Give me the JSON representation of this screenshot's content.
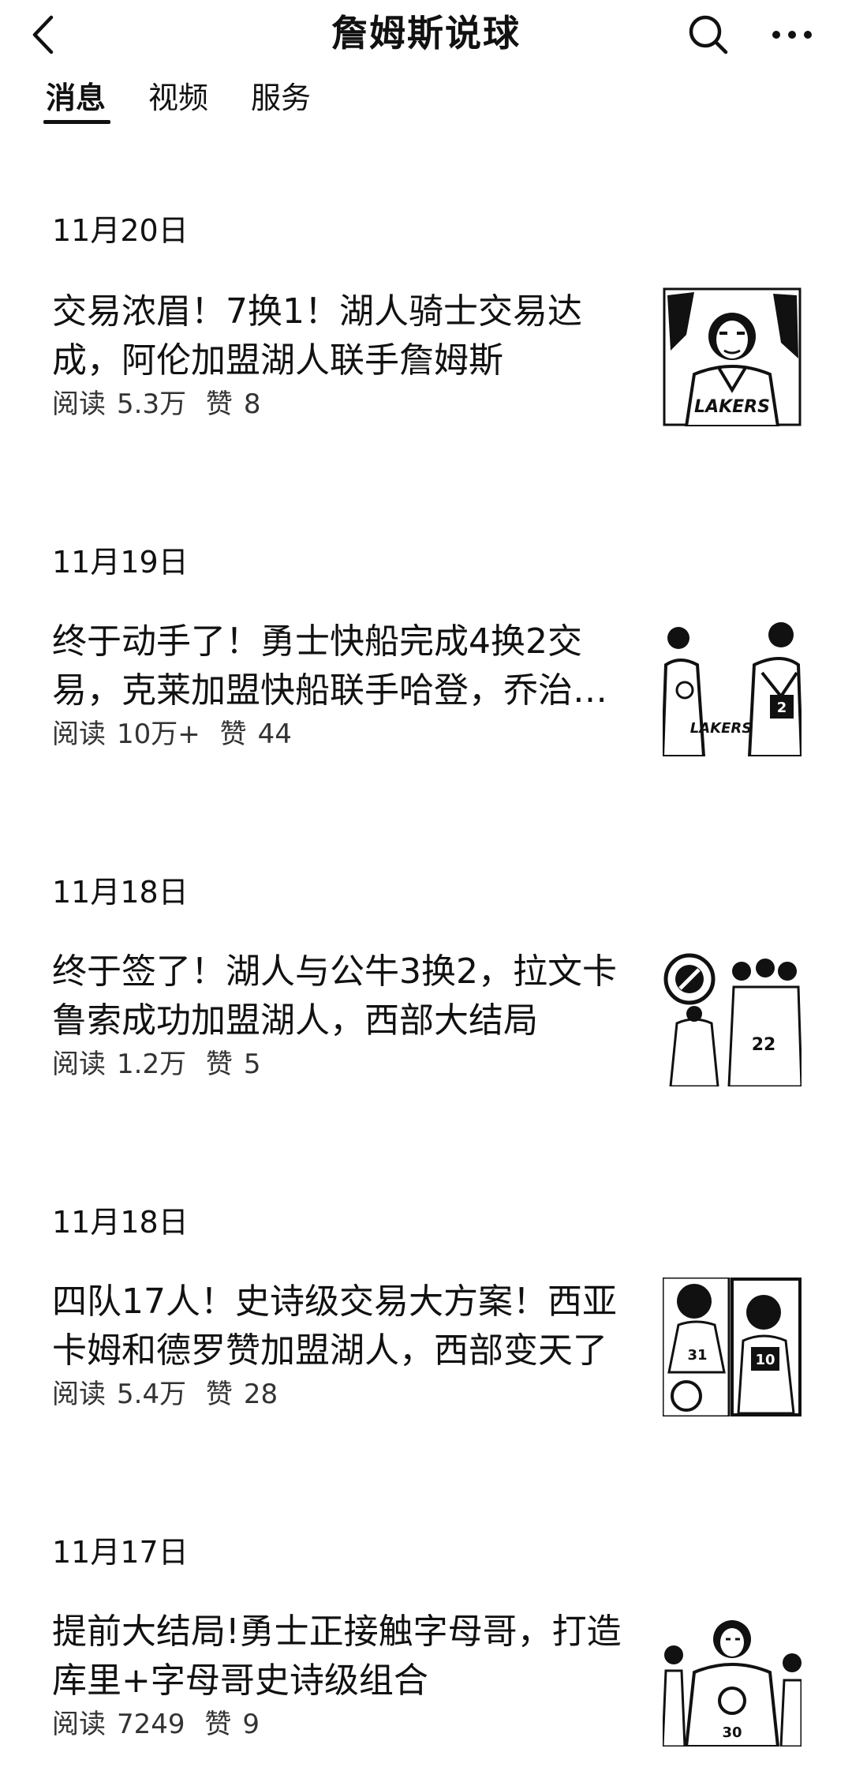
{
  "header": {
    "title": "詹姆斯说球",
    "back_icon": "chevron-left-icon",
    "search_icon": "search-icon",
    "more_icon": "more-horizontal-icon"
  },
  "tabs": [
    {
      "label": "消息",
      "active": true
    },
    {
      "label": "视频",
      "active": false
    },
    {
      "label": "服务",
      "active": false
    }
  ],
  "articles": [
    {
      "date": "11月20日",
      "title": "交易浓眉！7换1！湖人骑士交易达成，阿伦加盟湖人联手詹姆斯",
      "reads_label": "阅读",
      "reads": "5.3万",
      "likes_label": "赞",
      "likes": "8",
      "thumb_text": "LAKERS"
    },
    {
      "date": "11月19日",
      "title": "终于动手了！勇士快船完成4换2交易，克莱加盟快船联手哈登，乔治…",
      "reads_label": "阅读",
      "reads": "10万+",
      "likes_label": "赞",
      "likes": "44",
      "thumb_text": "LAKERS"
    },
    {
      "date": "11月18日",
      "title": "终于签了！湖人与公牛3换2，拉文卡鲁索成功加盟湖人，西部大结局",
      "reads_label": "阅读",
      "reads": "1.2万",
      "likes_label": "赞",
      "likes": "5",
      "thumb_text": "22"
    },
    {
      "date": "11月18日",
      "title": "四队17人！史诗级交易大方案！西亚卡姆和德罗赞加盟湖人，西部变天了",
      "reads_label": "阅读",
      "reads": "5.4万",
      "likes_label": "赞",
      "likes": "28",
      "thumb_text": "31"
    },
    {
      "date": "11月17日",
      "title": "提前大结局!勇士正接触字母哥，打造库里+字母哥史诗级组合",
      "reads_label": "阅读",
      "reads": "7249",
      "likes_label": "赞",
      "likes": "9",
      "thumb_text": "30"
    }
  ]
}
